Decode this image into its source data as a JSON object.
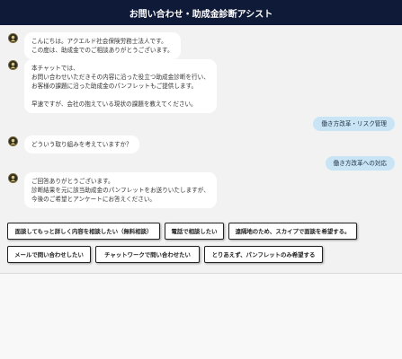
{
  "header": {
    "title": "お問い合わせ・助成金診断アシスト"
  },
  "messages": [
    {
      "from": "bot",
      "text": "こんにちは。アクエルド社会保険労務士法人です。\nこの度は、助成金でのご相談ありがとうございます。"
    },
    {
      "from": "bot",
      "text": "本チャットでは、\nお問い合わせいただきその内容に沿った役立つ助成金診断を行い、\nお客様の課題に沿った助成金のパンフレットもご提供します。\n\n早速ですが、会社の抱えている現状の課題を教えてください。"
    },
    {
      "from": "user",
      "text": "働き方改革・リスク管理"
    },
    {
      "from": "bot",
      "text": "どういう取り組みを考えていますか？"
    },
    {
      "from": "user",
      "text": "働き方改革への対応"
    },
    {
      "from": "bot",
      "text": "ご回答ありがとうございます。\n診断結果を元に該当助成金のパンフレットをお送りいたしますが、\n今後のご希望とアンケートにお答えください。"
    }
  ],
  "options": [
    "面談してもっと詳しく内容を相談したい（無料相談）",
    "電話で相談したい",
    "遠隔地のため、スカイプで面談を希望する。",
    "メールで問い合わせしたい",
    "チャットワークで問い合わせたい",
    "とりあえず、パンフレットのみ希望する"
  ],
  "icons": {
    "bot_avatar": "bot-avatar-icon"
  },
  "colors": {
    "header_bg": "#0f1a38",
    "user_bubble": "#c9e4f4",
    "bot_bubble": "#ffffff",
    "page_bg": "#f2f2f2"
  }
}
